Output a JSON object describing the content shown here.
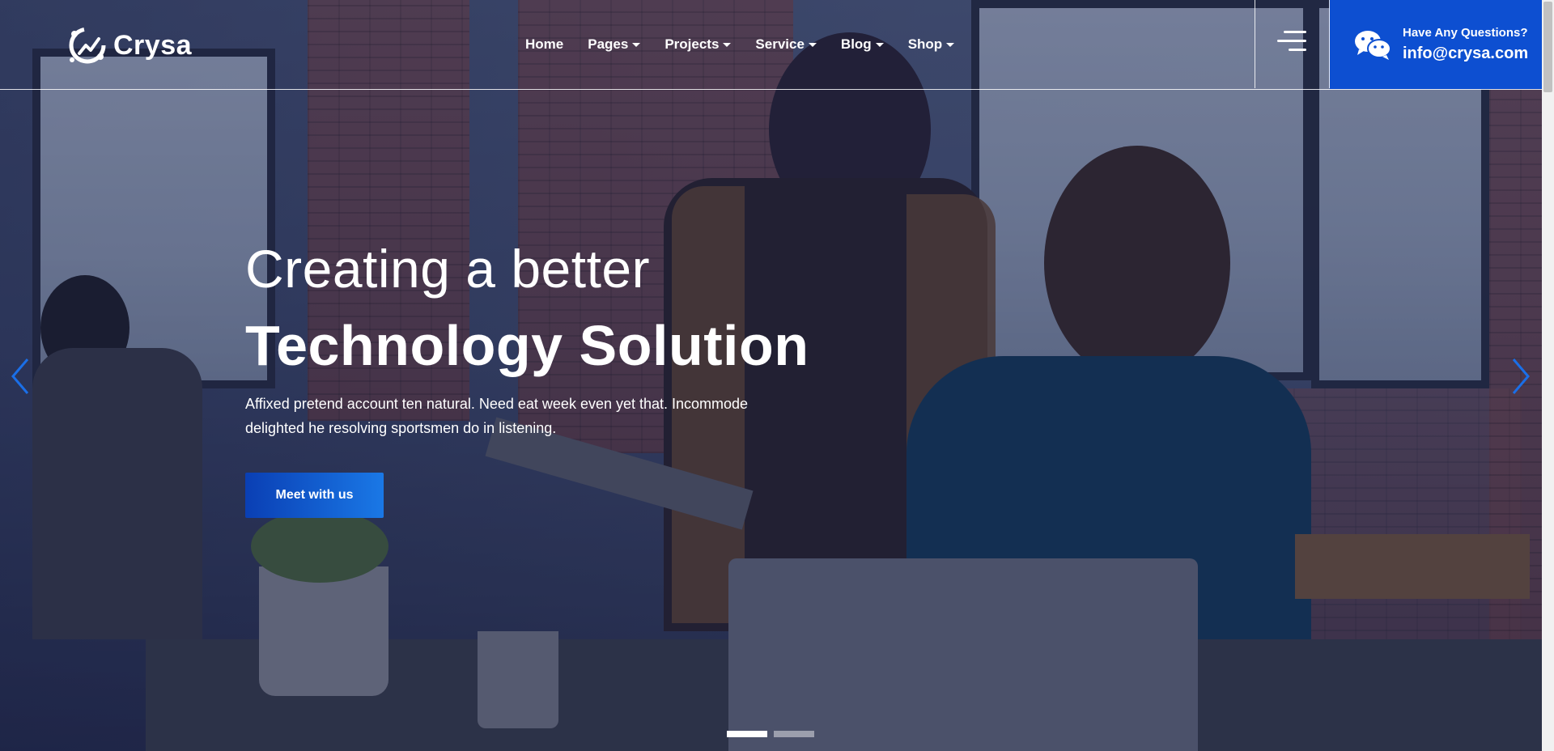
{
  "brand": {
    "name": "Crysa",
    "accent": "#0d4fd1"
  },
  "nav": {
    "items": [
      {
        "label": "Home",
        "dropdown": false
      },
      {
        "label": "Pages",
        "dropdown": true
      },
      {
        "label": "Projects",
        "dropdown": true
      },
      {
        "label": "Service",
        "dropdown": true
      },
      {
        "label": "Blog",
        "dropdown": true
      },
      {
        "label": "Shop",
        "dropdown": true
      }
    ]
  },
  "contact": {
    "question": "Have Any Questions?",
    "email": "info@crysa.com",
    "icon": "wechat-icon"
  },
  "hero": {
    "line1": "Creating a better",
    "line2": "Technology Solution",
    "description": "Affixed pretend account ten natural. Need eat week even yet that. Incommode delighted he resolving sportsmen do in listening.",
    "cta_label": "Meet with us"
  },
  "slider": {
    "slide_count": 2,
    "active_index": 0
  }
}
